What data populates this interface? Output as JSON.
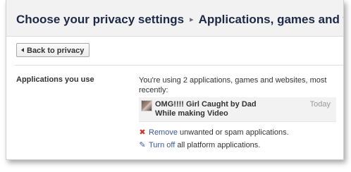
{
  "header": {
    "title": "Choose your privacy settings",
    "crumb_separator": "▸",
    "subtitle": "Applications, games and websites"
  },
  "back_button": {
    "label": "Back to privacy"
  },
  "section": {
    "label": "Applications you use",
    "summary": "You're using 2 applications, games and websites, most recently:",
    "app": {
      "name": "OMG!!!! Girl Caught by Dad While making Video",
      "time": "Today",
      "thumbnail_icon": "app-thumbnail"
    },
    "remove": {
      "icon": "x-icon",
      "link": "Remove",
      "text": " unwanted or spam applications."
    },
    "turn_off": {
      "icon": "pencil-icon",
      "link": "Turn off",
      "text": " all platform applications."
    }
  },
  "colors": {
    "heading": "#1c2a47",
    "link": "#3b5998",
    "remove_icon": "#d0362c",
    "header_bg": "#f2f2f2"
  }
}
